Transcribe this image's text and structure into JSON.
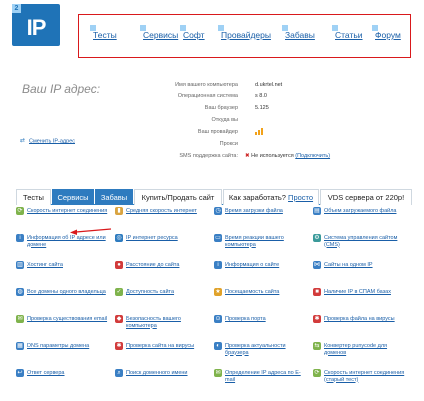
{
  "logo": {
    "badge": "2",
    "text": "IP"
  },
  "nav": [
    {
      "label": "Тесты"
    },
    {
      "label": "Сервисы"
    },
    {
      "label": "Софт"
    },
    {
      "label": "Провайдеры"
    },
    {
      "label": "Забавы"
    },
    {
      "label": "Статьи"
    },
    {
      "label": "Форум"
    }
  ],
  "ip_section": {
    "title": "Ваш IP адрес:",
    "change_link": "Сменить IP-адрес",
    "rows": [
      {
        "label": "Имя вашего компьютера",
        "value": "d.ukrtel.net"
      },
      {
        "label": "Операционная система",
        "value": "s 8.0"
      },
      {
        "label": "Ваш браузер",
        "value": "5.125"
      },
      {
        "label": "Откуда вы",
        "value": ""
      },
      {
        "label": "Ваш провайдер",
        "value": ""
      },
      {
        "label": "Прокси",
        "value": ""
      },
      {
        "label": "SMS поддержка сайта:",
        "value": ""
      }
    ],
    "sms_status": "Не используется",
    "sms_link": "(Подключить)",
    "sms_icon": "cross-icon"
  },
  "tabs": [
    {
      "label": "Тесты",
      "active": false
    },
    {
      "label": "Сервисы",
      "active": true
    },
    {
      "label": "Забавы",
      "active": true
    },
    {
      "label": "Купить/Продать сайт",
      "active": false
    },
    {
      "label": "Как заработать?",
      "extra": "Просто",
      "active": false
    },
    {
      "label": "VDS сервера от 220р!",
      "active": false
    }
  ],
  "grid": [
    [
      "Скорость интернет соединения",
      "Средняя скорость интернет",
      "Время загрузки файла",
      "Объем загружаемого файла"
    ],
    [
      "Информация об IP адресе или домене",
      "IP интернет ресурса",
      "Время реакции вашего компьютера",
      "Система управления сайтом (CMS)"
    ],
    [
      "Хостинг сайта",
      "Расстояние до сайта",
      "Информация о сайте",
      "Сайты на одном IP"
    ],
    [
      "Все домены одного владельца",
      "Доступность сайта",
      "Посещаемость сайта",
      "Наличие IP в СПАМ базах"
    ],
    [
      "Проверка существования email",
      "Безопасность вашего компьютера",
      "Проверка порта",
      "Проверка файла на вирусы"
    ],
    [
      "DNS параметры домена",
      "Проверка сайта на вирусы",
      "Проверка актуальности браузера",
      "Конвертер punycode для доменов"
    ],
    [
      "Ответ сервера",
      "Поиск доменного имени",
      "Определение IP адреса по E-mail",
      "Скорость интернет соединения (старый тест)"
    ]
  ],
  "colors": {
    "accent": "#2e7bbf",
    "link": "#1a5fa8",
    "nav_border": "#d9191c"
  }
}
